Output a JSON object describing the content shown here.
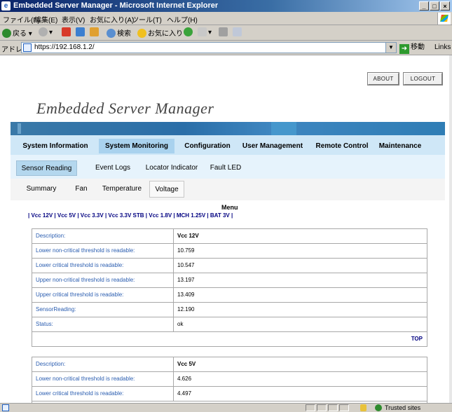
{
  "window": {
    "title": "Embedded Server Manager - Microsoft Internet Explorer"
  },
  "menubar": [
    "ファイル(F)",
    "編集(E)",
    "表示(V)",
    "お気に入り(A)",
    "ツール(T)",
    "ヘルプ(H)"
  ],
  "toolbar": {
    "back": "戻る",
    "search": "検索",
    "favorites": "お気に入り"
  },
  "address": {
    "label": "アドレス(D)",
    "url": "https://192.168.1.2/",
    "go": "移動",
    "links": "Links"
  },
  "page": {
    "about": "ABOUT",
    "logout": "LOGOUT",
    "logo": "Embedded Server Manager",
    "main_tabs": [
      {
        "label": "System Information",
        "active": false
      },
      {
        "label": "System Monitoring",
        "active": true
      },
      {
        "label": "Configuration",
        "active": false
      },
      {
        "label": "User Management",
        "active": false
      },
      {
        "label": "Remote Control",
        "active": false
      },
      {
        "label": "Maintenance",
        "active": false
      }
    ],
    "sub_tabs": [
      {
        "label": "Sensor Reading",
        "active": true
      },
      {
        "label": "Event Logs",
        "active": false
      },
      {
        "label": "Locator Indicator",
        "active": false
      },
      {
        "label": "Fault LED",
        "active": false
      }
    ],
    "third_tabs": [
      {
        "label": "Summary",
        "active": false
      },
      {
        "label": "Fan",
        "active": false
      },
      {
        "label": "Temperature",
        "active": false
      },
      {
        "label": "Voltage",
        "active": true
      }
    ],
    "menu_title": "Menu",
    "menu_links": [
      "Vcc 12V",
      "Vcc 5V",
      "Vcc 3.3V",
      "Vcc 3.3V STB",
      "Vcc 1.8V",
      "MCH 1.25V",
      "BAT 3V"
    ],
    "top_label": "TOP",
    "sensors": [
      {
        "rows": [
          {
            "label": "Description:",
            "value": "Vcc 12V"
          },
          {
            "label": "Lower non-critical threshold is readable:",
            "value": "10.759"
          },
          {
            "label": "Lower critical threshold is readable:",
            "value": "10.547"
          },
          {
            "label": "Upper non-critical threshold is readable:",
            "value": "13.197"
          },
          {
            "label": "Upper critical threshold is readable:",
            "value": "13.409"
          },
          {
            "label": "SensorReading:",
            "value": "12.190"
          },
          {
            "label": "Status:",
            "value": "ok"
          }
        ]
      },
      {
        "rows": [
          {
            "label": "Description:",
            "value": "Vcc 5V"
          },
          {
            "label": "Lower non-critical threshold is readable:",
            "value": "4.626"
          },
          {
            "label": "Lower critical threshold is readable:",
            "value": "4.497"
          }
        ]
      }
    ]
  },
  "statusbar": {
    "zone": "Trusted sites"
  }
}
